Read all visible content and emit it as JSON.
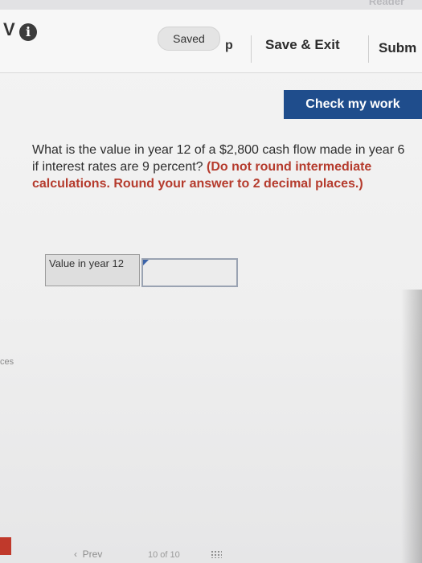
{
  "top": {
    "reader_label": "Reader",
    "v_letter": "V",
    "info_icon": "i"
  },
  "header": {
    "saved_label": "Saved",
    "help_partial": "p",
    "save_exit_label": "Save & Exit",
    "submit_partial": "Subm"
  },
  "check_button_label": "Check my work",
  "question": {
    "text_plain": "What is the value in year 12 of a $2,800 cash flow made in year 6 if interest rates are 9 percent? ",
    "text_instructions": "(Do not round intermediate calculations. Round your answer to 2 decimal places.)"
  },
  "answer": {
    "label": "Value in year 12",
    "value": ""
  },
  "side": {
    "ces_label": "ces"
  },
  "footer": {
    "prev_label": "Prev",
    "page_counter": "10 of 10"
  },
  "colors": {
    "check_button": "#1f4d8c",
    "instruction_red": "#b53b2d",
    "input_border": "#9aa3b2"
  },
  "icons": [
    "info-icon",
    "chevron-left-icon",
    "grid-icon"
  ]
}
